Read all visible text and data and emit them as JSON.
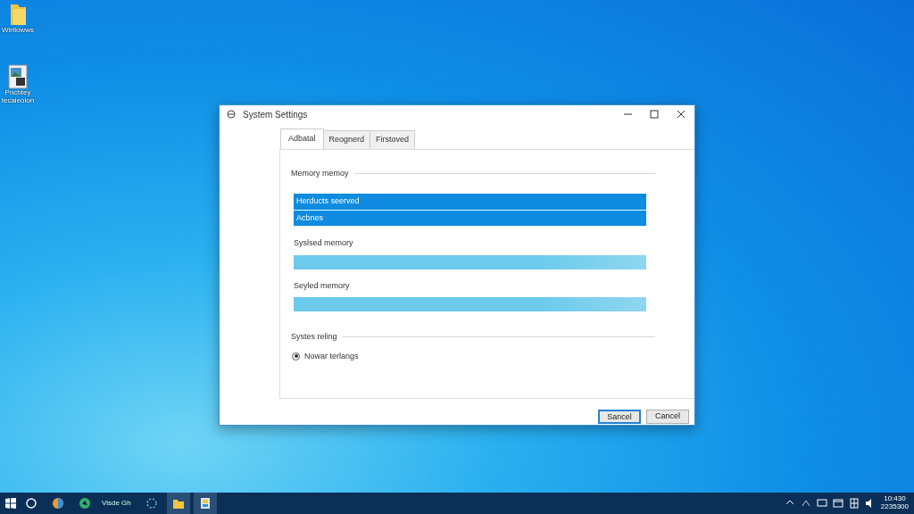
{
  "desktop_icons": [
    {
      "kind": "folder",
      "label": "Wirtlowws"
    },
    {
      "kind": "document",
      "label": "Pnchtey tecaleolon"
    }
  ],
  "window": {
    "title": "System Settings",
    "tabs": [
      {
        "label": "Adbatal",
        "selected": true
      },
      {
        "label": "Reognerd",
        "selected": false
      },
      {
        "label": "Firstoved",
        "selected": false
      }
    ],
    "sections": [
      {
        "title": "Memory memoy",
        "list": [
          {
            "label": "Herducts seerved",
            "selected": true
          },
          {
            "label": "Acbnes",
            "selected": true
          }
        ],
        "fields": [
          {
            "label": "Syslsed memory"
          },
          {
            "label": "Seyled memory"
          }
        ]
      },
      {
        "title": "Systes reling",
        "radios": [
          {
            "label": "Nowar terlangs",
            "selected": true
          }
        ]
      }
    ],
    "buttons": [
      {
        "label": "Sancel",
        "default": true
      },
      {
        "label": "Cancel",
        "default": false
      }
    ]
  },
  "taskbar": {
    "apps": [
      {
        "kind": "search"
      },
      {
        "kind": "browser"
      },
      {
        "kind": "green"
      },
      {
        "kind": "text",
        "label": "Visde Gh"
      },
      {
        "kind": "ring"
      },
      {
        "kind": "folder"
      },
      {
        "kind": "files"
      }
    ],
    "clock": {
      "time": "10:430",
      "date": "2235300"
    }
  }
}
